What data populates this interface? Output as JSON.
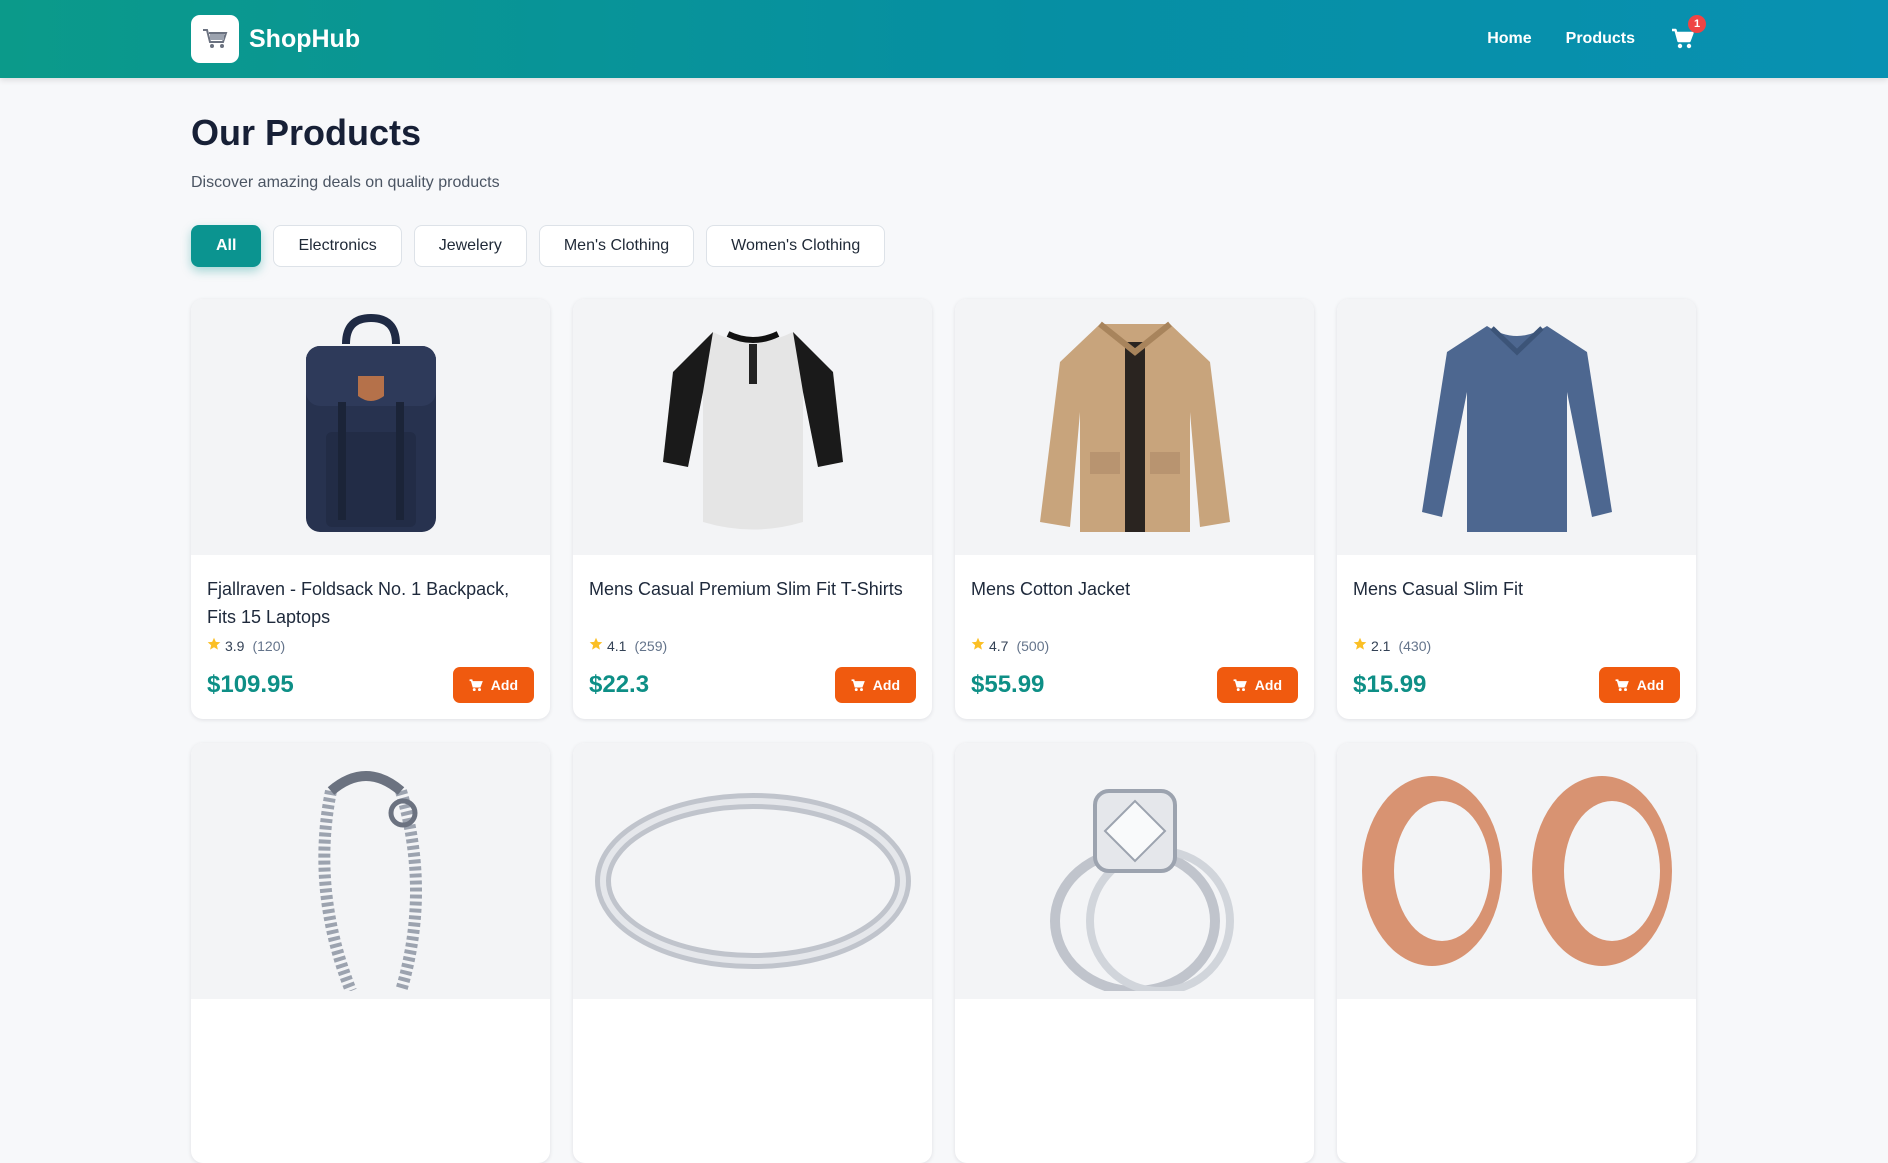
{
  "brand": {
    "name": "ShopHub",
    "icon": "shopping-cart-icon"
  },
  "nav": {
    "home": "Home",
    "products": "Products",
    "cart_count": "1"
  },
  "page": {
    "title": "Our Products",
    "subtitle": "Discover amazing deals on quality products"
  },
  "filters": [
    "All",
    "Electronics",
    "Jewelery",
    "Men's Clothing",
    "Women's Clothing"
  ],
  "active_filter": "All",
  "add_label": "Add",
  "products": [
    {
      "title": "Fjallraven - Foldsack No. 1 Backpack, Fits 15 Laptops",
      "rating": "3.9",
      "count": "(120)",
      "price": "$109.95"
    },
    {
      "title": "Mens Casual Premium Slim Fit T-Shirts",
      "rating": "4.1",
      "count": "(259)",
      "price": "$22.3"
    },
    {
      "title": "Mens Cotton Jacket",
      "rating": "4.7",
      "count": "(500)",
      "price": "$55.99"
    },
    {
      "title": "Mens Casual Slim Fit",
      "rating": "2.1",
      "count": "(430)",
      "price": "$15.99"
    },
    {
      "title": "",
      "rating": "",
      "count": "",
      "price": ""
    },
    {
      "title": "",
      "rating": "",
      "count": "",
      "price": ""
    },
    {
      "title": "",
      "rating": "",
      "count": "",
      "price": ""
    },
    {
      "title": "",
      "rating": "",
      "count": "",
      "price": ""
    }
  ],
  "colors": {
    "accent": "#0b9490",
    "price": "#0e8f86",
    "add_button": "#f05a0f",
    "badge": "#ef4444",
    "star": "#fbbf24"
  }
}
